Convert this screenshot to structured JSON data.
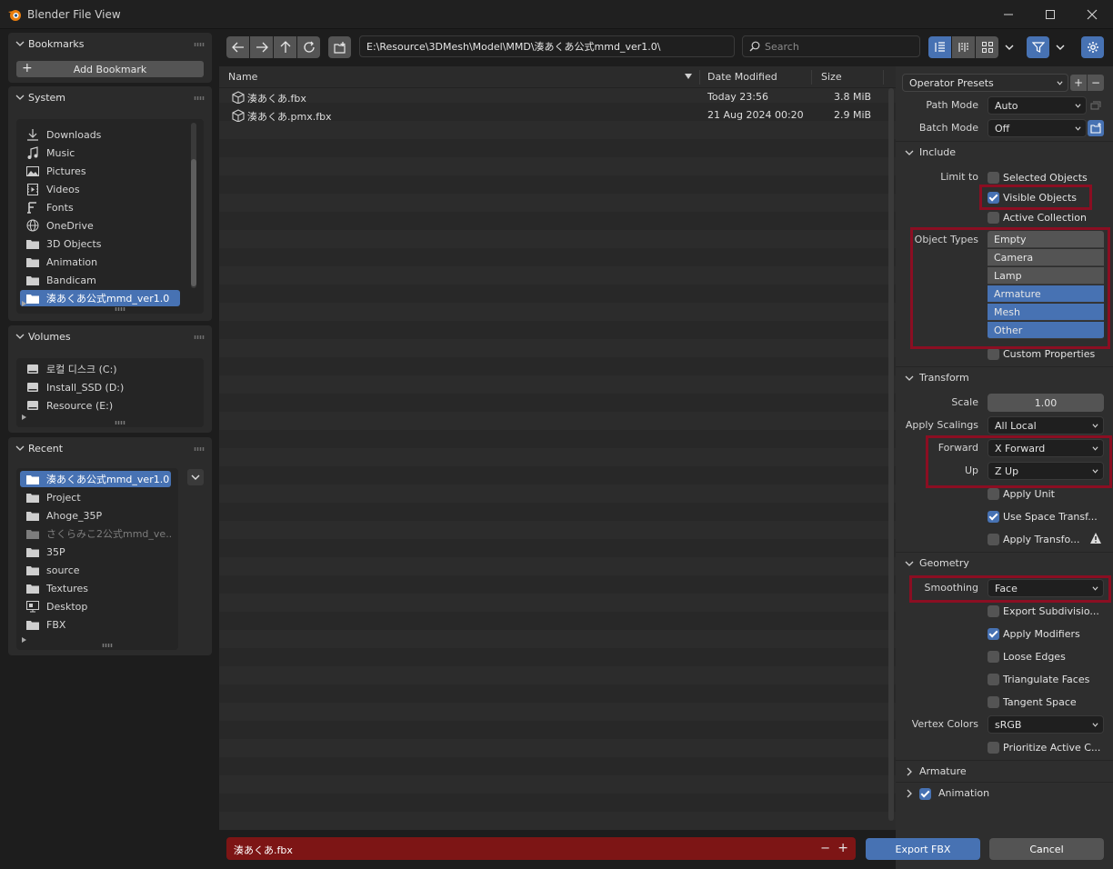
{
  "window": {
    "title": "Blender File View"
  },
  "sidebar": {
    "bookmarks": {
      "title": "Bookmarks",
      "add_label": "Add Bookmark"
    },
    "system": {
      "title": "System",
      "items": [
        {
          "label": "Downloads",
          "icon": "download-icon"
        },
        {
          "label": "Music",
          "icon": "music-icon"
        },
        {
          "label": "Pictures",
          "icon": "image-icon"
        },
        {
          "label": "Videos",
          "icon": "video-icon"
        },
        {
          "label": "Fonts",
          "icon": "font-icon"
        },
        {
          "label": "OneDrive",
          "icon": "globe-icon"
        },
        {
          "label": "3D Objects",
          "icon": "folder-icon"
        },
        {
          "label": "Animation",
          "icon": "folder-icon"
        },
        {
          "label": "Bandicam",
          "icon": "folder-icon"
        },
        {
          "label": "湊あくあ公式mmd_ver1.0",
          "icon": "folder-icon",
          "selected": true
        }
      ]
    },
    "volumes": {
      "title": "Volumes",
      "items": [
        {
          "label": "로컬 디스크 (C:)",
          "icon": "disk-icon"
        },
        {
          "label": "Install_SSD (D:)",
          "icon": "disk-icon"
        },
        {
          "label": "Resource (E:)",
          "icon": "disk-icon"
        }
      ]
    },
    "recent": {
      "title": "Recent",
      "items": [
        {
          "label": "湊あくあ公式mmd_ver1.0",
          "icon": "folder-icon",
          "selected": true
        },
        {
          "label": "Project",
          "icon": "folder-icon"
        },
        {
          "label": "Ahoge_35P",
          "icon": "folder-icon"
        },
        {
          "label": "さくらみこ2公式mmd_ve...",
          "icon": "folder-icon",
          "dim": true
        },
        {
          "label": "35P",
          "icon": "folder-icon"
        },
        {
          "label": "source",
          "icon": "folder-icon"
        },
        {
          "label": "Textures",
          "icon": "folder-icon"
        },
        {
          "label": "Desktop",
          "icon": "desktop-icon"
        },
        {
          "label": "FBX",
          "icon": "folder-icon"
        }
      ]
    }
  },
  "toolbar": {
    "path": "E:\\Resource\\3DMesh\\Model\\MMD\\湊あくあ公式mmd_ver1.0\\",
    "search_placeholder": "Search"
  },
  "filelist": {
    "columns": {
      "name": "Name",
      "date": "Date Modified",
      "size": "Size"
    },
    "files": [
      {
        "name": "湊あくあ.fbx",
        "date": "Today 23:56",
        "size": "3.8 MiB"
      },
      {
        "name": "湊あくあ.pmx.fbx",
        "date": "21 Aug 2024 00:20",
        "size": "2.9 MiB"
      }
    ]
  },
  "bottom": {
    "filename": "湊あくあ.fbx",
    "minus": "−",
    "plus": "+",
    "export_label": "Export FBX",
    "cancel_label": "Cancel"
  },
  "settings": {
    "presets": "Operator Presets",
    "path_mode_label": "Path Mode",
    "path_mode": "Auto",
    "batch_mode_label": "Batch Mode",
    "batch_mode": "Off",
    "include": {
      "title": "Include",
      "limit_to_label": "Limit to",
      "selected_objects": "Selected Objects",
      "visible_objects": "Visible Objects",
      "active_collection": "Active Collection",
      "object_types_label": "Object Types",
      "object_types": [
        {
          "label": "Empty",
          "on": false
        },
        {
          "label": "Camera",
          "on": false
        },
        {
          "label": "Lamp",
          "on": false
        },
        {
          "label": "Armature",
          "on": true
        },
        {
          "label": "Mesh",
          "on": true
        },
        {
          "label": "Other",
          "on": true
        }
      ],
      "custom_properties": "Custom Properties"
    },
    "transform": {
      "title": "Transform",
      "scale_label": "Scale",
      "scale": "1.00",
      "apply_scalings_label": "Apply Scalings",
      "apply_scalings": "All Local",
      "forward_label": "Forward",
      "forward": "X Forward",
      "up_label": "Up",
      "up": "Z Up",
      "apply_unit": "Apply Unit",
      "use_space": "Use Space Transf...",
      "apply_transform": "Apply Transfo..."
    },
    "geometry": {
      "title": "Geometry",
      "smoothing_label": "Smoothing",
      "smoothing": "Face",
      "export_subdiv": "Export Subdivisio...",
      "apply_modifiers": "Apply Modifiers",
      "loose_edges": "Loose Edges",
      "triangulate": "Triangulate Faces",
      "tangent_space": "Tangent Space",
      "vertex_colors_label": "Vertex Colors",
      "vertex_colors": "sRGB",
      "prioritize": "Prioritize Active C..."
    },
    "armature": {
      "title": "Armature"
    },
    "animation": {
      "title": "Animation"
    }
  },
  "colors": {
    "accent": "#4772b3",
    "highlight": "#8b0e22",
    "filename_bg": "#7d1515"
  }
}
